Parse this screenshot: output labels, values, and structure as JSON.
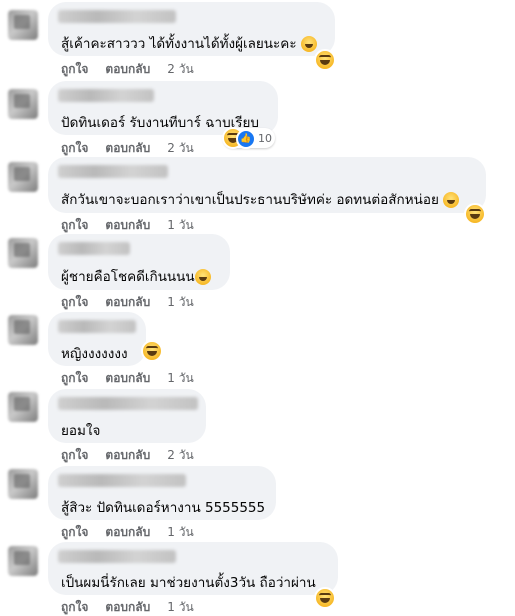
{
  "actions": {
    "like": "ถูกใจ",
    "reply": "ตอบกลับ"
  },
  "comments": [
    {
      "text": "สู้เค้าคะสาววว ได้ทั้งงานได้ทั้งผู้เลยนะคะ",
      "inline_emoji": "grinning-sweat-emoji",
      "time": "2 วัน",
      "reactions": [
        "haha"
      ],
      "reaction_count": ""
    },
    {
      "text": "ปัดทินเดอร์ รับงานทีบาร์ ฉาบเรียบ",
      "inline_emoji": "",
      "time": "2 วัน",
      "reactions": [
        "haha",
        "like"
      ],
      "reaction_count": "10"
    },
    {
      "text": "สักวันเขาจะบอกเราว่าเขาเป็นประธานบริษัทค่ะ อดทนต่อสักหน่อย",
      "inline_emoji": "rofl-emoji",
      "time": "1 วัน",
      "reactions": [
        "haha"
      ],
      "reaction_count": ""
    },
    {
      "text": "ผู้ชายคือโชคดีเกินนนน",
      "inline_emoji": "grinning-sweat-emoji",
      "time": "1 วัน",
      "reactions": [],
      "reaction_count": ""
    },
    {
      "text": "หญิงงงงงงง",
      "inline_emoji": "",
      "time": "1 วัน",
      "reactions": [
        "haha"
      ],
      "reaction_count": ""
    },
    {
      "text": "ยอมใจ",
      "inline_emoji": "",
      "time": "2 วัน",
      "reactions": [],
      "reaction_count": ""
    },
    {
      "text": "สู้สิวะ ปัดทินเดอร์หางาน 5555555",
      "inline_emoji": "",
      "time": "1 วัน",
      "reactions": [],
      "reaction_count": ""
    },
    {
      "text": "เป็นผมนี่รักเลย มาช่วยงานตั้ง3วัน ถือว่าผ่าน",
      "inline_emoji": "",
      "time": "1 วัน",
      "reactions": [
        "haha"
      ],
      "reaction_count": ""
    }
  ]
}
